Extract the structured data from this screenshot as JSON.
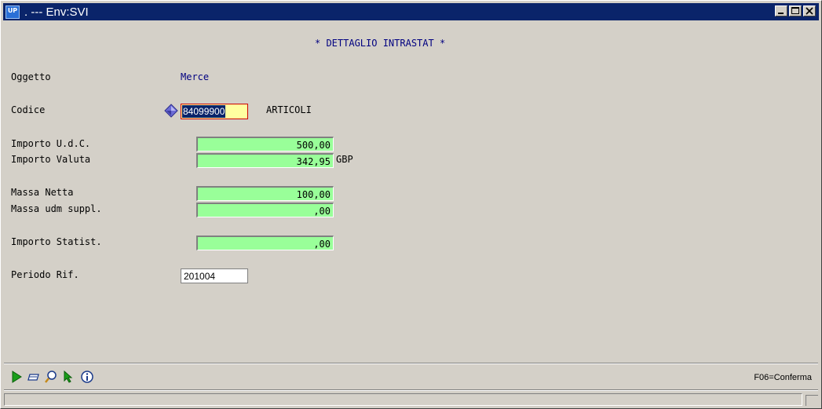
{
  "window": {
    "title": ". --- Env:SVI",
    "app_icon_text": "UP"
  },
  "form": {
    "heading": "* DETTAGLIO INTRASTAT *",
    "oggetto_label": "Oggetto",
    "oggetto_value": "Merce",
    "codice_label": "Codice",
    "codice_value": "84099900",
    "codice_desc": "ARTICOLI",
    "importo_udc_label": "Importo U.d.C.",
    "importo_udc_value": "500,00",
    "importo_valuta_label": "Importo Valuta",
    "importo_valuta_value": "342,95",
    "importo_valuta_currency": "GBP",
    "massa_netta_label": "Massa Netta",
    "massa_netta_value": "100,00",
    "massa_udm_label": "Massa udm suppl.",
    "massa_udm_value": ",00",
    "importo_statist_label": "Importo Statist.",
    "importo_statist_value": ",00",
    "periodo_label": "Periodo Rif.",
    "periodo_value": "201004"
  },
  "toolbar": {
    "icons": [
      "play-icon",
      "eraser-icon",
      "magnifier-icon",
      "cursor-icon",
      "info-icon"
    ],
    "hint": "F06=Conferma"
  },
  "colors": {
    "field_green": "#99ff99",
    "title_bar": "#0a246a",
    "text_blue": "#000080"
  }
}
